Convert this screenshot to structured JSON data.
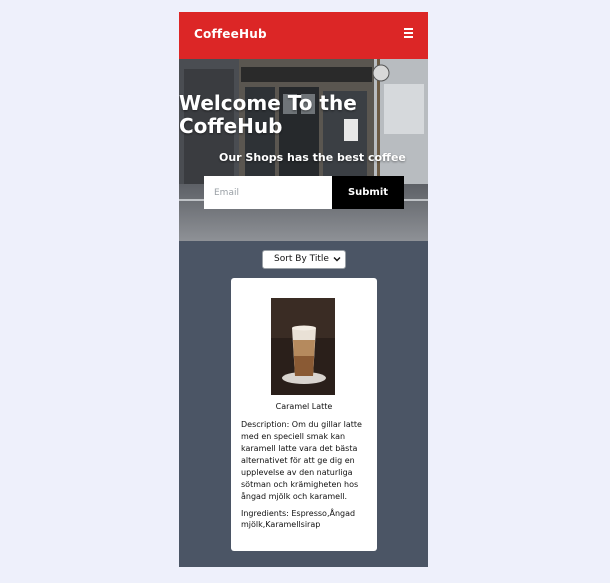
{
  "navbar": {
    "brand": "CoffeeHub",
    "menu_icon": "hamburger-icon"
  },
  "hero": {
    "title": "Welcome To the CoffeHub",
    "subtitle": "Our Shops has the best coffee",
    "email_placeholder": "Email",
    "submit_label": "Submit"
  },
  "sort": {
    "selected": "Sort By Title",
    "icon": "chevron-down-icon"
  },
  "products": [
    {
      "title": "Caramel Latte",
      "description": "Description: Om du gillar latte med en speciell smak kan karamell latte vara det bästa alternativet för att ge dig en upplevelse av den naturliga sötman och krämigheten hos ångad mjölk och karamell.",
      "ingredients": "Ingredients: Espresso,Ångad mjölk,Karamellsirap"
    }
  ],
  "colors": {
    "navbar": "#dc2626",
    "background": "#4b5565",
    "page": "#eef0fb",
    "submit": "#000000"
  }
}
